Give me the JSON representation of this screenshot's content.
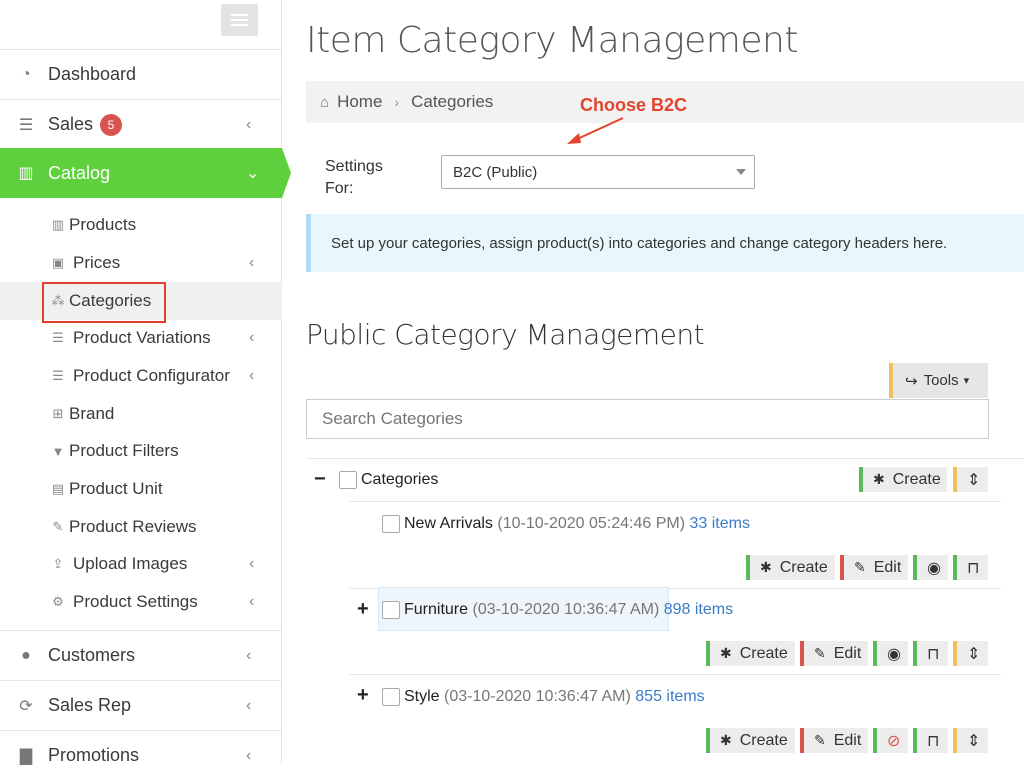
{
  "sidebar": {
    "items": [
      {
        "label": "Dashboard",
        "icon": "dashboard-icon"
      },
      {
        "label": "Sales",
        "icon": "sales-icon",
        "badge": "5"
      },
      {
        "label": "Catalog",
        "icon": "barcode-icon"
      },
      {
        "label": "Customers",
        "icon": "user-icon"
      },
      {
        "label": "Sales Rep",
        "icon": "refresh-icon"
      },
      {
        "label": "Promotions",
        "icon": "bar-chart-icon"
      }
    ],
    "catalog_sub": [
      {
        "label": "Products",
        "icon": "barcode-icon"
      },
      {
        "label": "Prices",
        "icon": "money-icon"
      },
      {
        "label": "Categories",
        "icon": "sitemap-icon"
      },
      {
        "label": "Product Variations",
        "icon": "list-icon"
      },
      {
        "label": "Product Configurator",
        "icon": "list-icon"
      },
      {
        "label": "Brand",
        "icon": "gift-icon"
      },
      {
        "label": "Product Filters",
        "icon": "filter-icon"
      },
      {
        "label": "Product Unit",
        "icon": "building-icon"
      },
      {
        "label": "Product Reviews",
        "icon": "edit-icon"
      },
      {
        "label": "Upload Images",
        "icon": "upload-icon"
      },
      {
        "label": "Product Settings",
        "icon": "gear-icon"
      }
    ]
  },
  "page": {
    "title": "Item Category Management",
    "breadcrumb": {
      "home": "Home",
      "current": "Categories"
    },
    "annotation": "Choose B2C",
    "settings_label_1": "Settings",
    "settings_label_2": "For:",
    "settings_value": "B2C (Public)",
    "info": "Set up your categories, assign product(s) into categories and change category headers here.",
    "subtitle": "Public Category Management",
    "tools_label": "Tools",
    "search_placeholder": "Search Categories"
  },
  "tree": {
    "root": "Categories",
    "create": "Create",
    "edit": "Edit",
    "rows": [
      {
        "name": "New Arrivals",
        "date": "(10-10-2020 05:24:46 PM)",
        "count": "33 items"
      },
      {
        "name": "Furniture",
        "date": "(03-10-2020 10:36:47 AM)",
        "count": "898 items"
      },
      {
        "name": "Style",
        "date": "(03-10-2020 10:36:47 AM)",
        "count": "855 items"
      }
    ]
  },
  "colors": {
    "accent": "#5ed03d",
    "annotation": "#e3442d",
    "link": "#3a7bc8",
    "badge": "#d9534f"
  }
}
